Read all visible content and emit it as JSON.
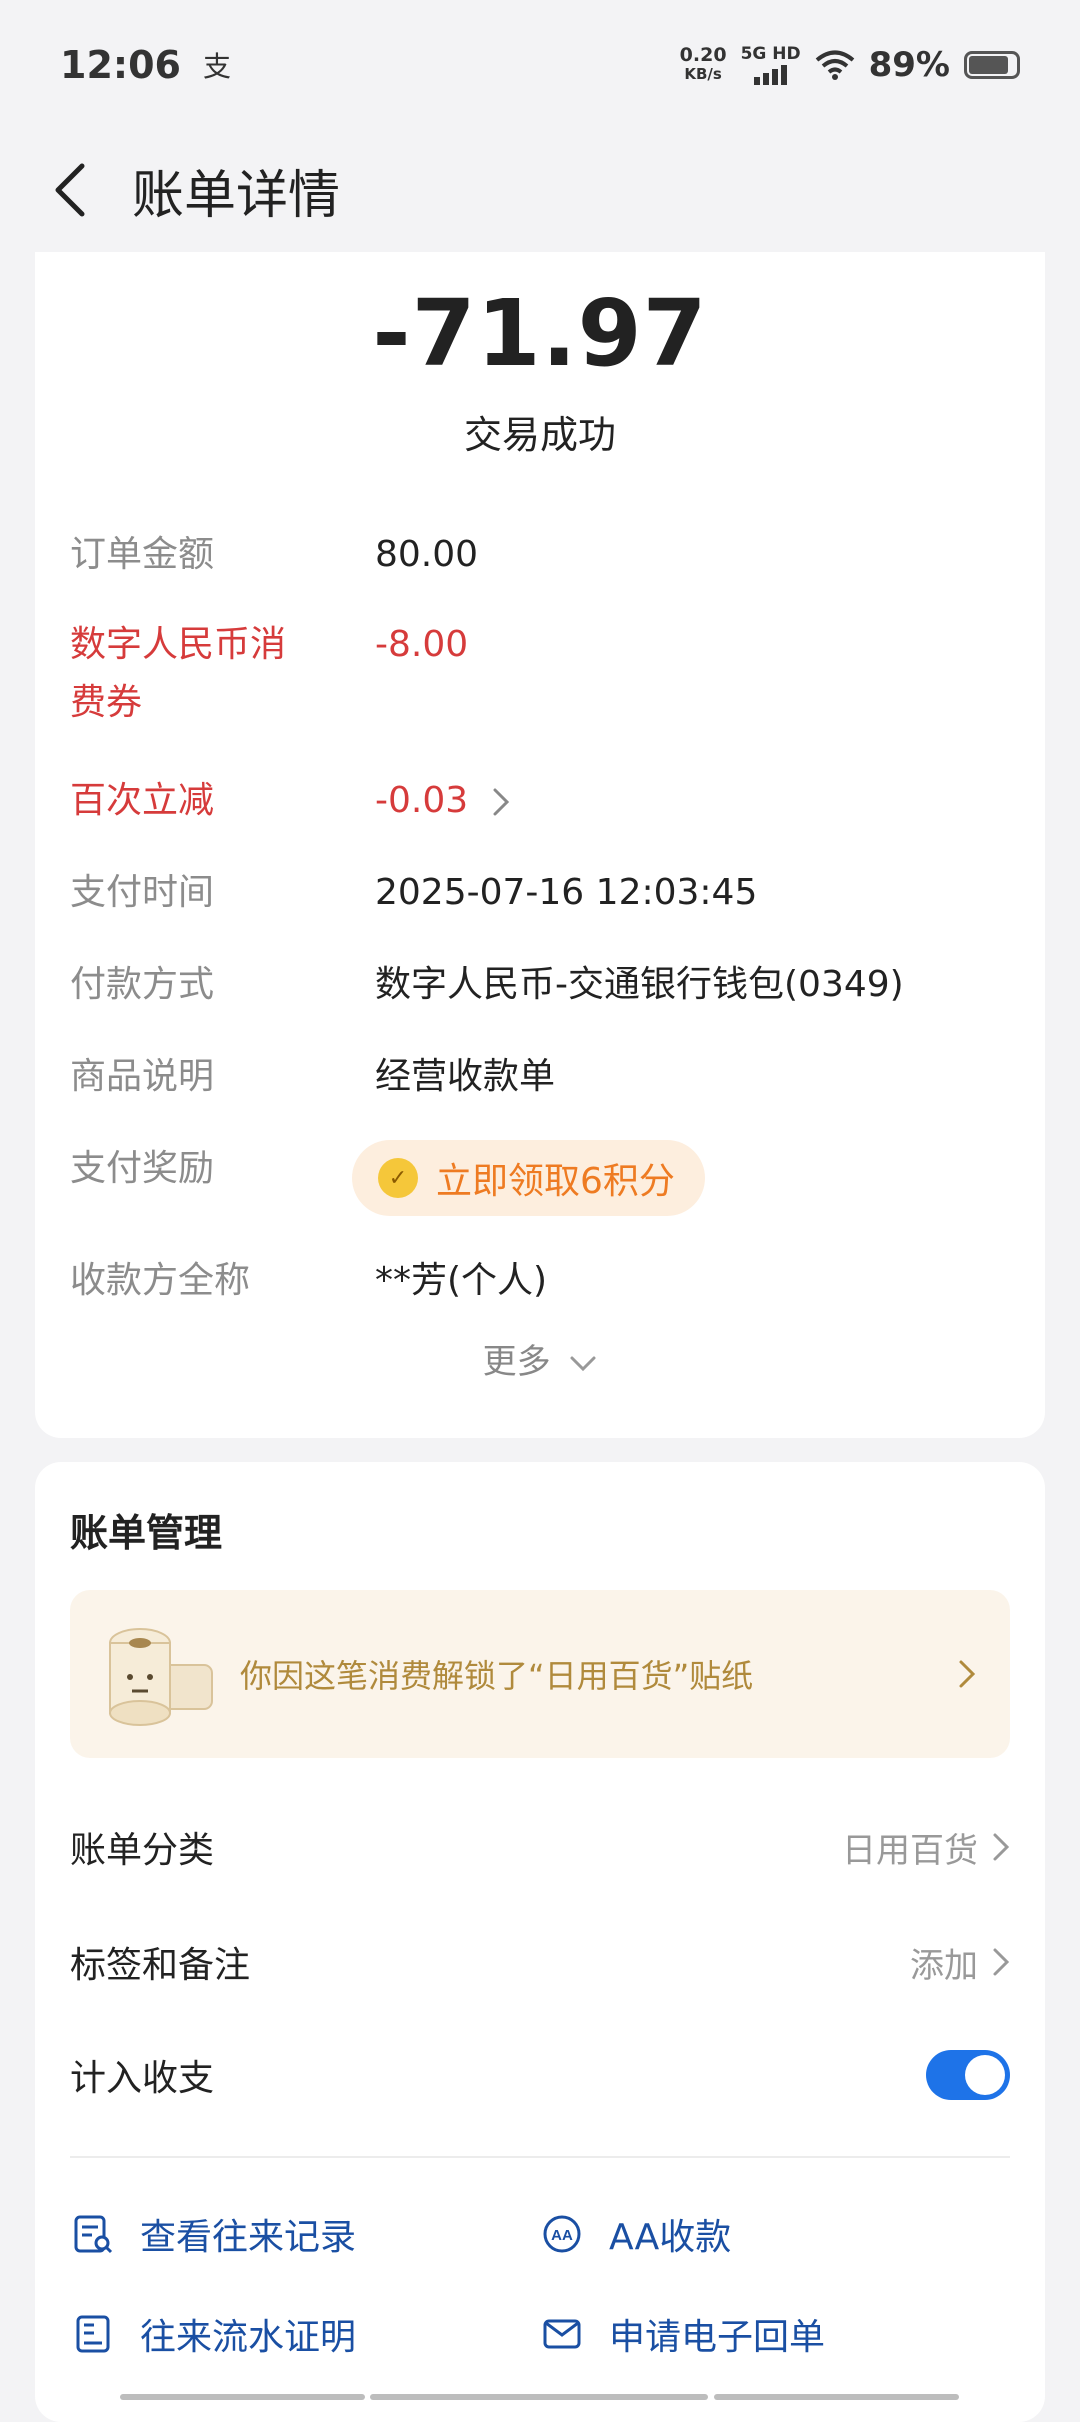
{
  "status_bar": {
    "time": "12:06",
    "app_icon": "支",
    "net_speed_value": "0.20",
    "net_speed_unit": "KB/s",
    "network": "5G HD",
    "battery": "89%"
  },
  "header": {
    "title": "账单详情"
  },
  "summary": {
    "amount": "-71.97",
    "status": "交易成功"
  },
  "details": [
    {
      "label": "订单金额",
      "value": "80.00"
    },
    {
      "label": "数字人民币消费券",
      "value": "-8.00"
    },
    {
      "label": "百次立减",
      "value": "-0.03"
    },
    {
      "label": "支付时间",
      "value": "2025-07-16 12:03:45"
    },
    {
      "label": "付款方式",
      "value": "数字人民币-交通银行钱包(0349)"
    },
    {
      "label": "商品说明",
      "value": "经营收款单"
    },
    {
      "label": "支付奖励",
      "value": "立即领取6积分"
    },
    {
      "label": "收款方全称",
      "value": "**芳(个人)"
    }
  ],
  "more_label": "更多",
  "management": {
    "title": "账单管理",
    "sticker_text": "你因这笔消费解锁了“日用百货”贴纸",
    "category_label": "账单分类",
    "category_value": "日用百货",
    "tags_label": "标签和备注",
    "tags_value": "添加",
    "count_label": "计入收支",
    "count_enabled": true
  },
  "actions": {
    "history": "查看往来记录",
    "aa": "AA收款",
    "proof": "往来流水证明",
    "receipt": "申请电子回单"
  },
  "colors": {
    "accent_blue": "#1e73e8",
    "discount_red": "#d63b3b",
    "reward_orange": "#ee7b22",
    "link_blue": "#1a4fa3"
  }
}
